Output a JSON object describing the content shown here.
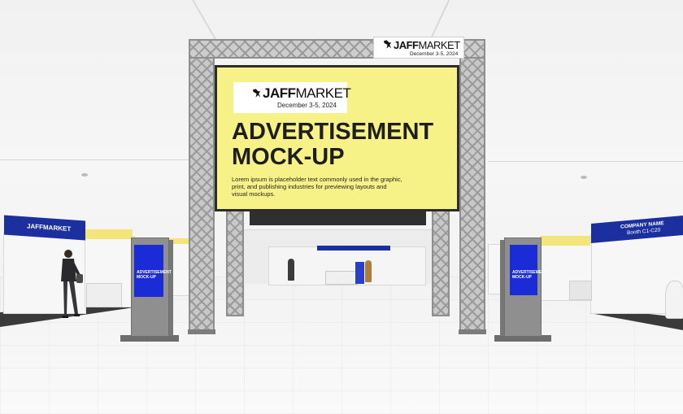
{
  "screen": {
    "logo_bold": "JAFF",
    "logo_light": "MARKET",
    "date": "December 3-5, 2024",
    "headline_line1": "ADVERTISEMENT",
    "headline_line2": "MOCK-UP",
    "body": "Lorem ipsum is placeholder text commonly used in the graphic, print, and publishing industries for previewing layouts and visual mockups."
  },
  "top_sign": {
    "logo_bold": "JAFF",
    "logo_light": "MARKET",
    "date": "December 3-5, 2024"
  },
  "booths": {
    "left_fascia": "JAFFMARKET",
    "right_fascia_line1": "COMPANY NAME",
    "right_fascia_line2": "Booth C1-C20"
  },
  "kiosks": {
    "line1": "ADVERTISEMENT",
    "line2": "MOCK-UP"
  },
  "colors": {
    "screen_yellow": "#f7f287",
    "booth_blue": "#1b2f9e",
    "kiosk_blue": "#1b2bd6"
  }
}
